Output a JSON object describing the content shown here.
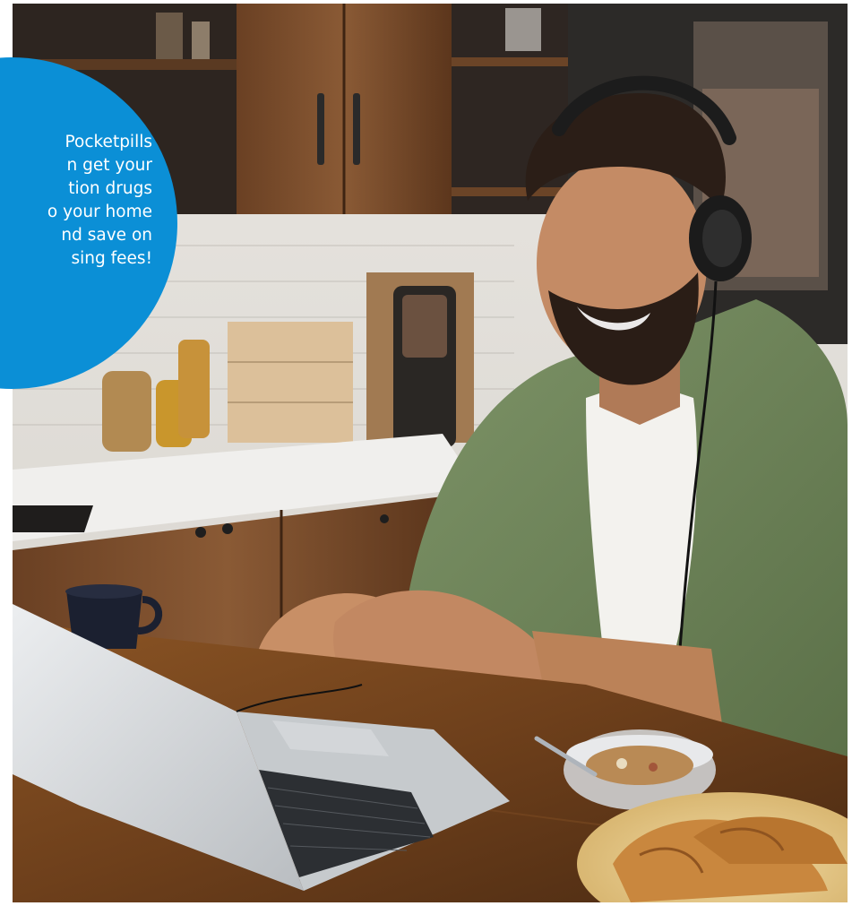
{
  "promo_bubble": {
    "text": "Pocketpills\nn get your\ntion drugs\no your home\nnd save on\nsing fees!",
    "color": "#0b8fd6",
    "text_color": "#ffffff"
  },
  "photo": {
    "subject_icon": "man-with-headphones-on-video-call-photo"
  }
}
